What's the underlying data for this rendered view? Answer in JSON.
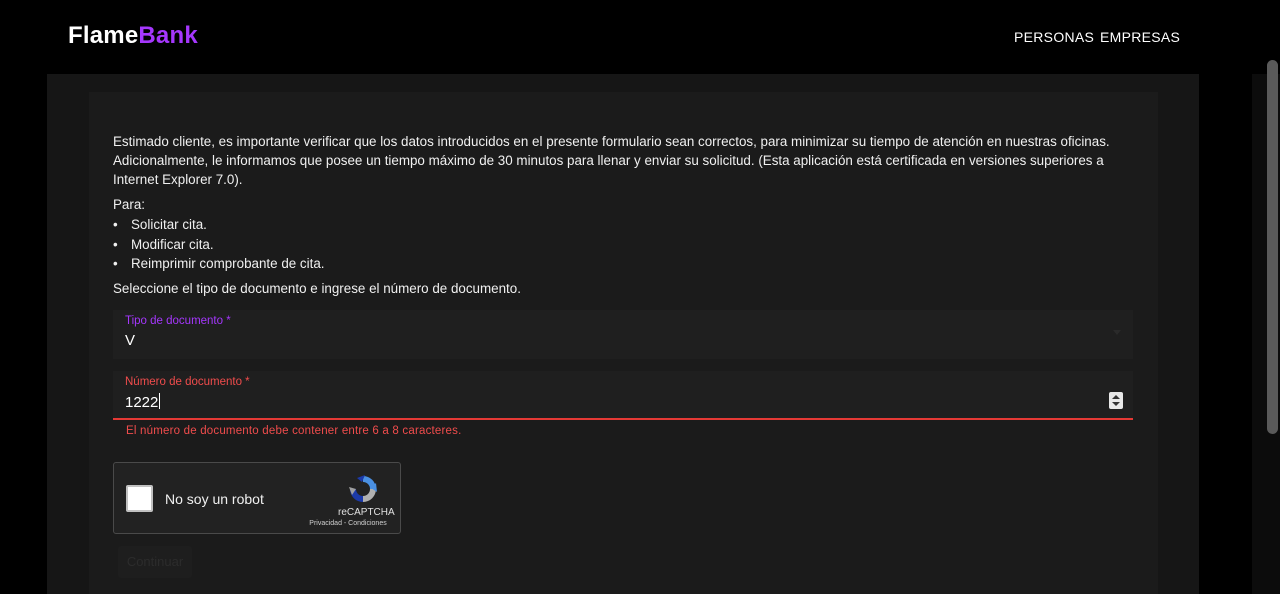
{
  "header": {
    "logo_part1": "Flame",
    "logo_part2": "Bank",
    "nav": [
      "PERSONAS",
      "EMPRESAS"
    ]
  },
  "intro": {
    "paragraph": "Estimado cliente, es importante verificar que los datos introducidos en el presente formulario sean correctos, para minimizar su tiempo de atención en nuestras oficinas. Adicionalmente, le informamos que posee un tiempo máximo de 30 minutos para llenar y enviar su solicitud. (Esta aplicación está certificada en versiones superiores a Internet Explorer 7.0).",
    "para_label": "Para:",
    "bullets": [
      "Solicitar cita.",
      "Modificar cita.",
      "Reimprimir comprobante de cita."
    ],
    "instruction": "Seleccione el tipo de documento e ingrese el número de documento."
  },
  "form": {
    "tipo_label": "Tipo de documento *",
    "tipo_value": "V",
    "numero_label": "Número de documento *",
    "numero_value": "1222",
    "numero_error": "El número de documento debe contener entre 6 a 8 caracteres."
  },
  "recaptcha": {
    "label": "No soy un robot",
    "brand": "reCAPTCHA",
    "links": "Privacidad - Condiciones"
  },
  "submit": {
    "label": "Continuar"
  },
  "colors": {
    "accent": "#a537fd",
    "error": "#f04c4c",
    "background": "#000000"
  }
}
